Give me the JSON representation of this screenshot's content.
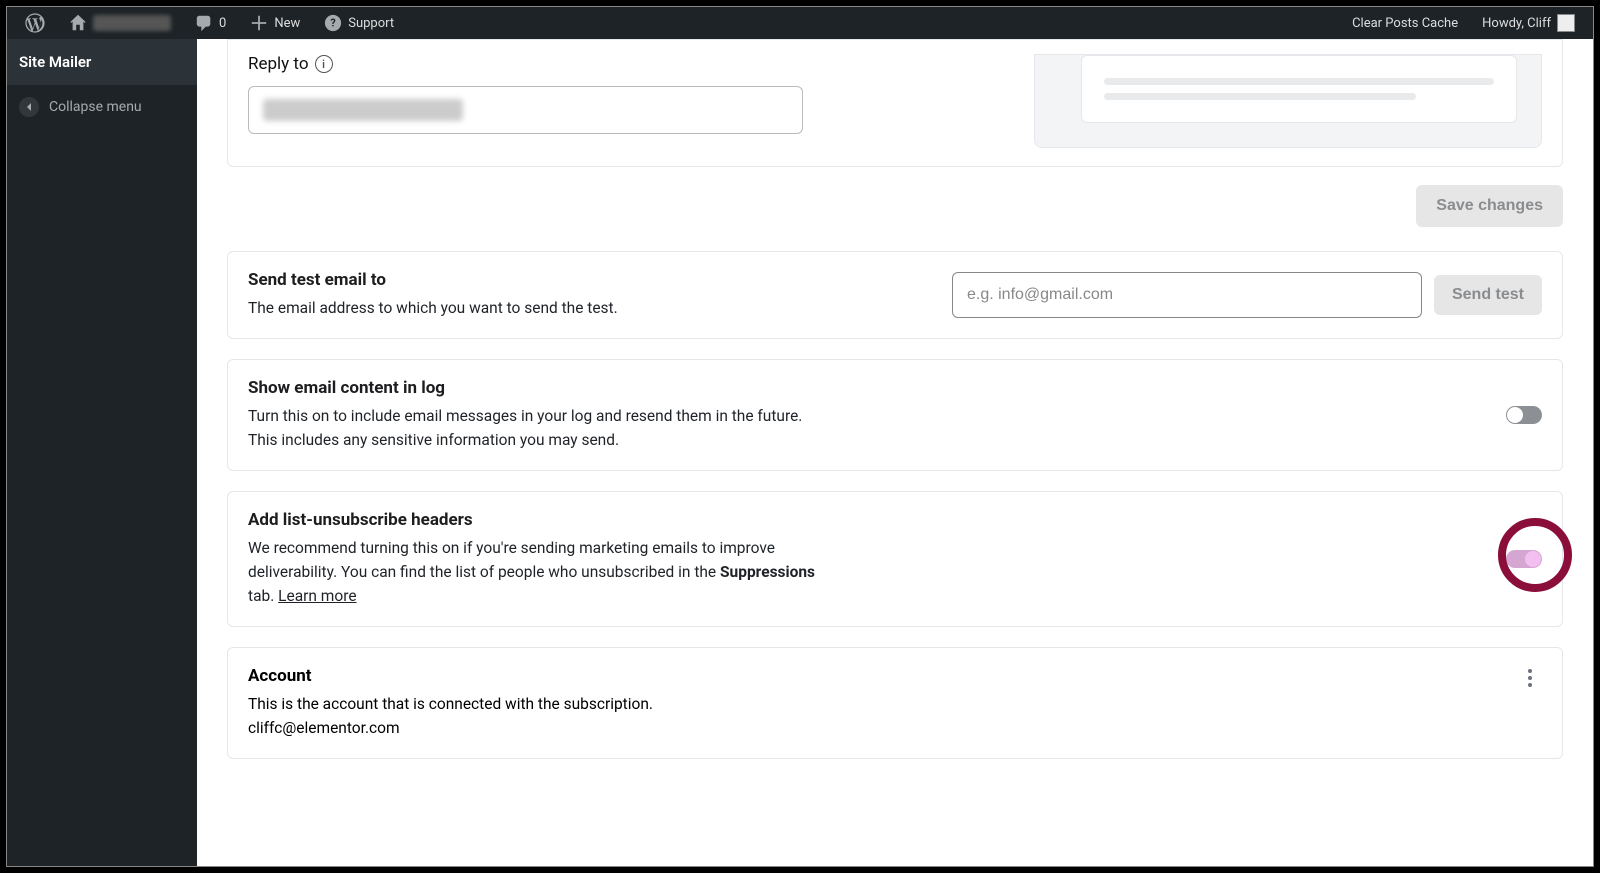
{
  "adminbar": {
    "comments": "0",
    "new": "New",
    "support": "Support",
    "clear_cache": "Clear Posts Cache",
    "howdy": "Howdy, Cliff"
  },
  "sidebar": {
    "site_mailer": "Site Mailer",
    "collapse": "Collapse menu"
  },
  "replyto": {
    "label": "Reply to"
  },
  "save_btn": "Save changes",
  "test": {
    "title": "Send test email to",
    "desc": "The email address to which you want to send the test.",
    "placeholder": "e.g. info@gmail.com",
    "button": "Send test"
  },
  "log": {
    "title": "Show email content in log",
    "line1": "Turn this on to include email messages in your log and resend them in the future.",
    "line2": "This includes any sensitive information you may send."
  },
  "unsub": {
    "title": "Add list-unsubscribe headers",
    "desc1": "We recommend turning this on if you're sending marketing emails to improve deliverability. You can find the list of people who unsubscribed in the ",
    "bold": "Suppressions",
    "desc2": " tab. ",
    "learn": "Learn more"
  },
  "account": {
    "title": "Account",
    "desc": "This is the account that is connected with the subscription.",
    "email": "cliffc@elementor.com"
  }
}
